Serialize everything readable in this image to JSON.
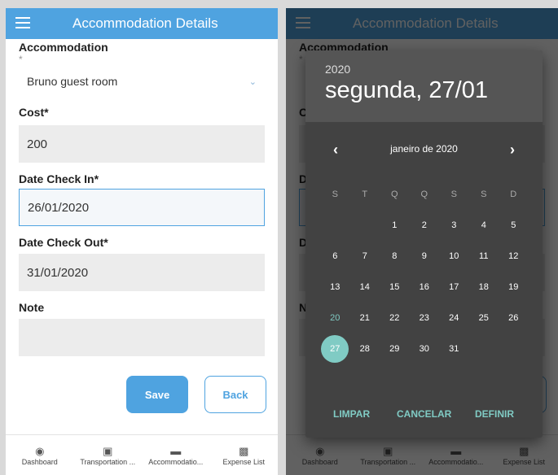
{
  "app": {
    "title": "Accommodation Details",
    "colors": {
      "primary": "#4fa3e0",
      "accent": "#80cbc4"
    }
  },
  "form": {
    "accommodation_label": "Accommodation",
    "accommodation_required": "*",
    "accommodation_value": "Bruno guest room",
    "cost_label": "Cost*",
    "cost_value": "200",
    "checkin_label": "Date Check In*",
    "checkin_value": "26/01/2020",
    "checkout_label": "Date Check Out*",
    "checkout_value": "31/01/2020",
    "note_label": "Note",
    "note_value": "",
    "save_label": "Save",
    "back_label": "Back"
  },
  "nav": {
    "items": [
      {
        "label": "Dashboard",
        "icon": "dashboard-icon"
      },
      {
        "label": "Transportation ...",
        "icon": "transport-icon"
      },
      {
        "label": "Accommodatio...",
        "icon": "bed-icon"
      },
      {
        "label": "Expense List",
        "icon": "money-icon"
      }
    ]
  },
  "datepicker": {
    "year": "2020",
    "selected_date_text": "segunda, 27/01",
    "month_label": "janeiro de 2020",
    "weekdays": [
      "S",
      "T",
      "Q",
      "Q",
      "S",
      "S",
      "D"
    ],
    "weeks": [
      [
        "",
        "",
        "1",
        "2",
        "3",
        "4",
        "5"
      ],
      [
        "6",
        "7",
        "8",
        "9",
        "10",
        "11",
        "12"
      ],
      [
        "13",
        "14",
        "15",
        "16",
        "17",
        "18",
        "19"
      ],
      [
        "20",
        "21",
        "22",
        "23",
        "24",
        "25",
        "26"
      ],
      [
        "27",
        "28",
        "29",
        "30",
        "31",
        "",
        ""
      ]
    ],
    "today": "20",
    "selected": "27",
    "clear_label": "LIMPAR",
    "cancel_label": "CANCELAR",
    "ok_label": "DEFINIR"
  }
}
